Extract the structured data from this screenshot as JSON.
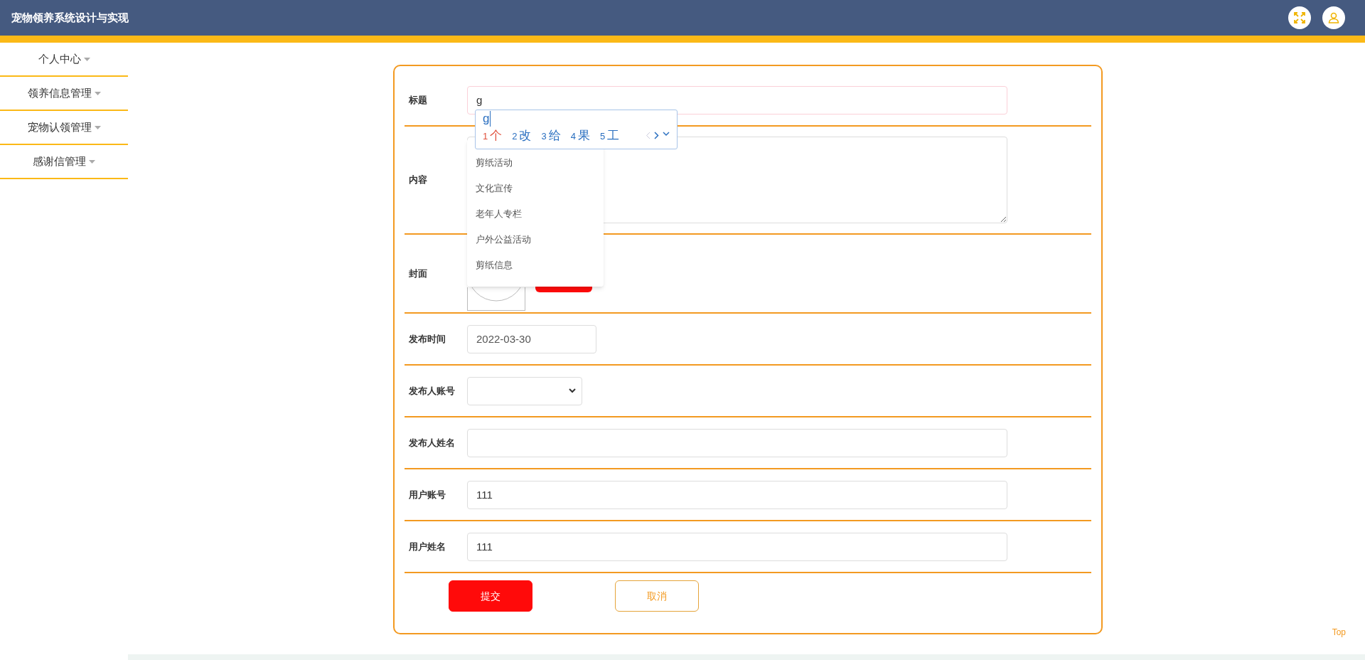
{
  "header": {
    "title": "宠物领养系统设计与实现"
  },
  "sidebar": {
    "items": [
      {
        "label": "个人中心"
      },
      {
        "label": "领养信息管理"
      },
      {
        "label": "宠物认领管理"
      },
      {
        "label": "感谢信管理"
      }
    ]
  },
  "form": {
    "fields": [
      {
        "kind": "text",
        "label": "标题",
        "value": "g"
      },
      {
        "kind": "textarea",
        "label": "内容"
      },
      {
        "kind": "image",
        "label": "封面"
      },
      {
        "kind": "date",
        "label": "发布时间",
        "value": "2022-03-30"
      },
      {
        "kind": "select",
        "label": "发布人账号"
      },
      {
        "kind": "text",
        "label": "发布人姓名"
      },
      {
        "kind": "text",
        "label": "用户账号",
        "value": "111"
      },
      {
        "kind": "text",
        "label": "用户姓名",
        "value": "111"
      }
    ],
    "buttons": [
      {
        "kind": "primary",
        "label": "提交"
      },
      {
        "kind": "outline",
        "label": "取消"
      }
    ]
  },
  "autocomplete": {
    "items": [
      "剪纸活动",
      "文化宣传",
      "老年人专栏",
      "户外公益活动",
      "剪纸信息"
    ]
  },
  "ime": {
    "composition": "g",
    "candidates": [
      {
        "number": "1",
        "char": "个",
        "selected": true
      },
      {
        "number": "2",
        "char": "改",
        "selected": false
      },
      {
        "number": "3",
        "char": "给",
        "selected": false
      },
      {
        "number": "4",
        "char": "果",
        "selected": false
      },
      {
        "number": "5",
        "char": "工",
        "selected": false
      }
    ]
  },
  "back_to_top": "Top"
}
